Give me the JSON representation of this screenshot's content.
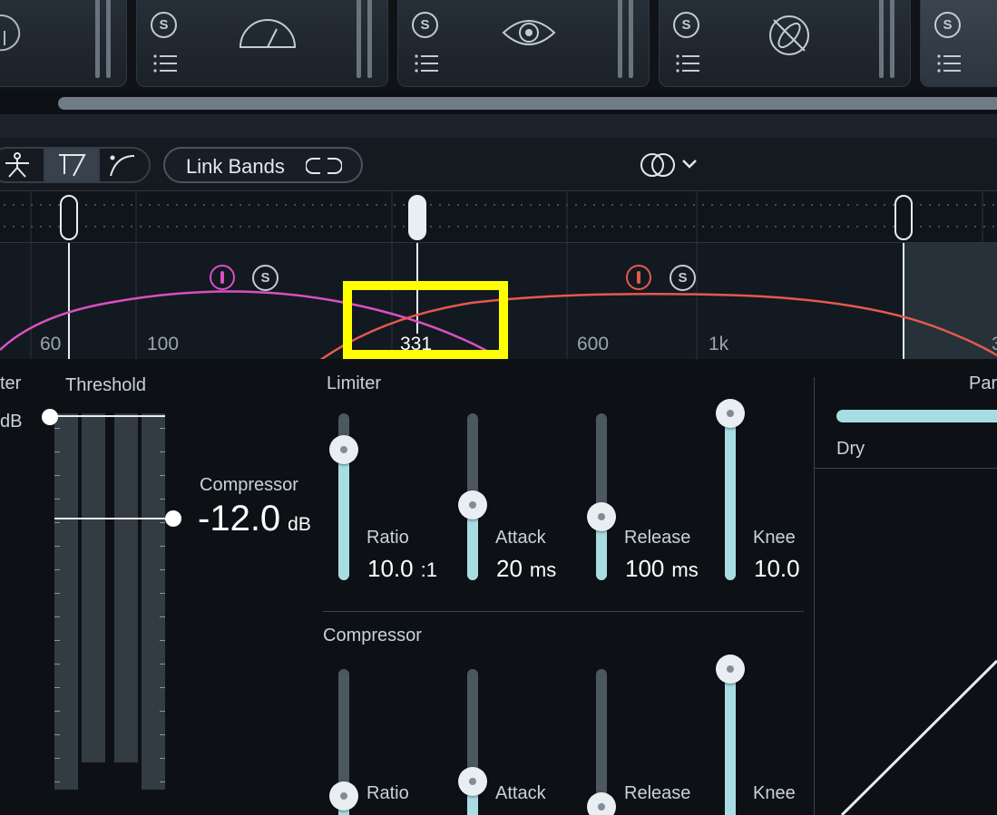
{
  "modules": [
    {
      "name": "eq-module",
      "solo": "S",
      "glyph": "spectrum-icon"
    },
    {
      "name": "dynamics-module",
      "solo": "S",
      "glyph": "meter-gauge-icon"
    },
    {
      "name": "visual-module",
      "solo": "S",
      "glyph": "eye-icon"
    },
    {
      "name": "disabled-module",
      "solo": "S",
      "glyph": "crossed-circle-icon"
    },
    {
      "name": "active-module",
      "solo": "S",
      "glyph": ""
    }
  ],
  "toolbar": {
    "link_bands_label": "Link Bands",
    "modes": [
      "band-mode-icon",
      "shelf-mode-icon",
      "curve-mode-icon"
    ]
  },
  "spectrum": {
    "freq_labels": [
      "60",
      "100",
      "331",
      "600",
      "1k",
      "3"
    ],
    "bands": [
      {
        "solo": "S",
        "color": "#d94fc4"
      },
      {
        "solo": "S",
        "color": "#e5594f"
      }
    ],
    "selected_crossover_value": "331"
  },
  "threshold": {
    "partial_label": "ter",
    "partial_unit": "dB",
    "label": "Threshold",
    "compressor_label": "Compressor",
    "compressor_value": "-12.0",
    "compressor_unit": "dB"
  },
  "limiter": {
    "title": "Limiter",
    "controls": [
      {
        "label": "Ratio",
        "value": "10.0",
        "unit": ":1",
        "level": 0.78
      },
      {
        "label": "Attack",
        "value": "20",
        "unit": "ms",
        "level": 0.45
      },
      {
        "label": "Release",
        "value": "100",
        "unit": "ms",
        "level": 0.38
      },
      {
        "label": "Knee",
        "value": "10.0",
        "unit": "",
        "level": 1.0
      }
    ]
  },
  "compressor": {
    "title": "Compressor",
    "controls": [
      {
        "label": "Ratio",
        "level": 0.3
      },
      {
        "label": "Attack",
        "level": 0.38
      },
      {
        "label": "Release",
        "level": 0.24
      },
      {
        "label": "Knee",
        "level": 1.0
      }
    ]
  },
  "mix": {
    "partial_label": "Par",
    "dry_label": "Dry",
    "level": 1.0
  },
  "colors": {
    "accent": "#a8dde3",
    "band1": "#d94fc4",
    "band2": "#e5594f",
    "highlight": "#ffff00"
  }
}
